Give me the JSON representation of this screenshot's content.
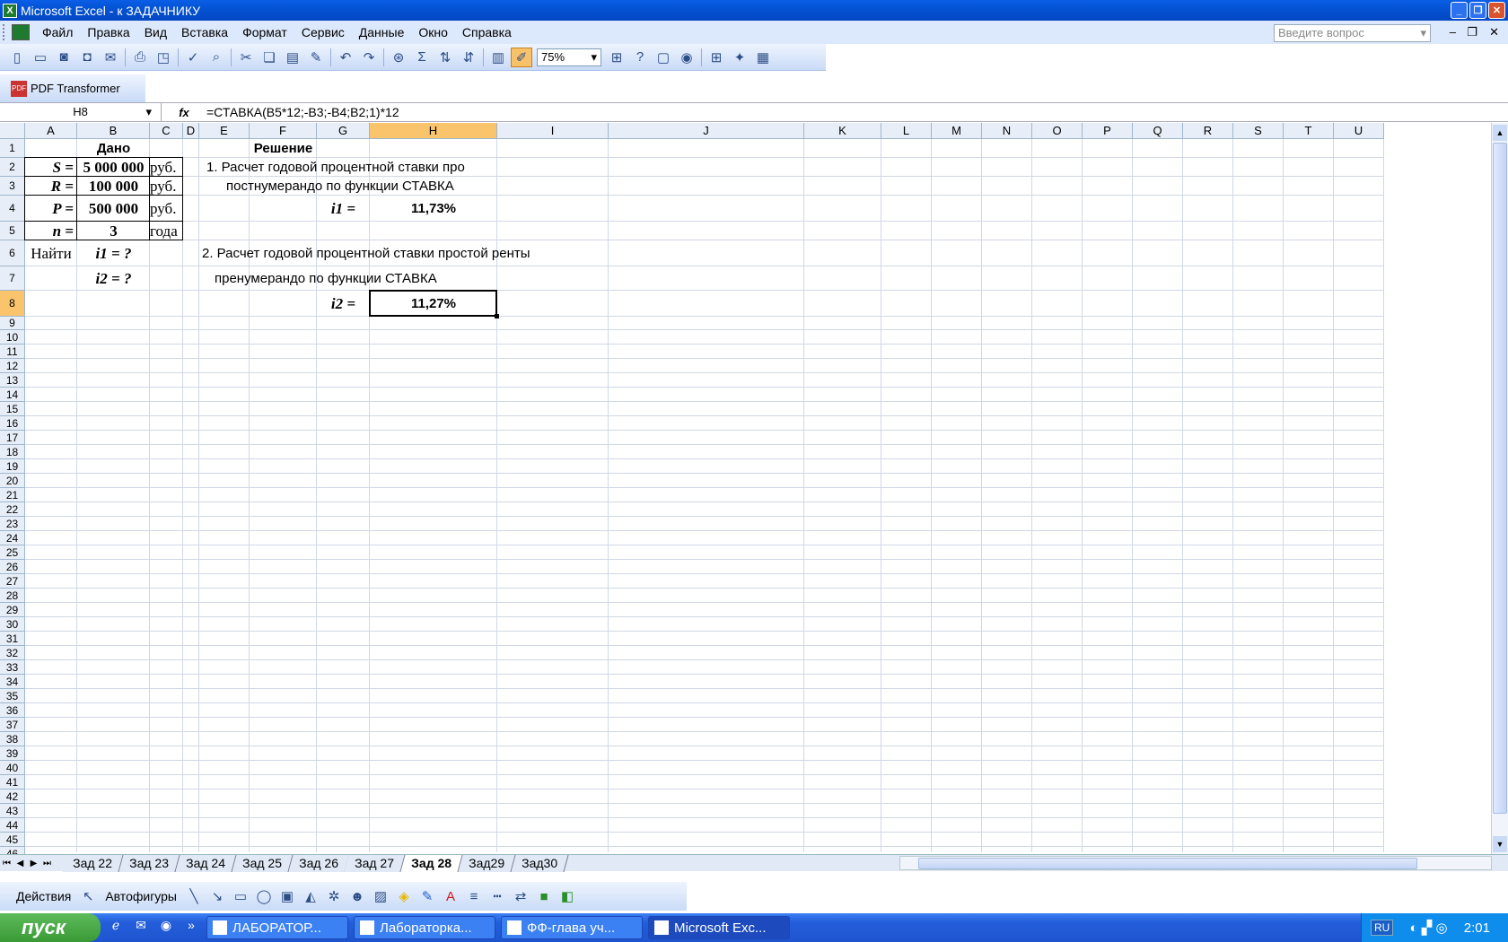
{
  "window": {
    "title": "Microsoft Excel - к ЗАДАЧНИКУ"
  },
  "menu": [
    "Файл",
    "Правка",
    "Вид",
    "Вставка",
    "Формат",
    "Сервис",
    "Данные",
    "Окно",
    "Справка"
  ],
  "help_placeholder": "Введите вопрос",
  "zoom": "75%",
  "pdf_toolbar": "PDF Transformer",
  "namebox": "H8",
  "formula": "=СТАВКА(B5*12;-B3;-B4;B2;1)*12",
  "columns": [
    "A",
    "B",
    "C",
    "D",
    "E",
    "F",
    "G",
    "H",
    "I",
    "J",
    "K",
    "L",
    "M",
    "N",
    "O",
    "P",
    "Q",
    "R",
    "S",
    "T",
    "U"
  ],
  "selected_column": "H",
  "selected_row": 8,
  "cells": {
    "B1": "Дано",
    "F1": "Решение",
    "A2": "S =",
    "B2": "5 000 000",
    "C2": "руб.",
    "A3": "R =",
    "B3": "100 000",
    "C3": "руб.",
    "A4": "P =",
    "B4": "500 000",
    "C4": "руб.",
    "A5": "n =",
    "B5": "3",
    "C5": "года",
    "A6": "Найти",
    "B6": "i1 = ?",
    "B7": "i2 = ?",
    "E2": "1. Расчет годовой процентной ставки про",
    "E3": "постнумерандо по функции СТАВКА",
    "G4": "i1 =",
    "H4": "11,73%",
    "E6": "2. Расчет годовой процентной ставки простой ренты",
    "E7": "пренумерандо по функции СТАВКА",
    "G8": "i2 =",
    "H8": "11,27%"
  },
  "sheet_tabs": [
    "Зад 22",
    "Зад 23",
    "Зад 24",
    "Зад 25",
    "Зад 26",
    "Зад 27",
    "Зад 28",
    "Зад29",
    "Зад30"
  ],
  "active_tab": "Зад 28",
  "drawing_toolbar": {
    "actions": "Действия",
    "autoshapes": "Автофигуры"
  },
  "taskbar": {
    "start": "пуск",
    "tasks": [
      "ЛАБОРАТОР...",
      "Лабораторка...",
      "ФФ-глава уч...",
      "Microsoft Exc..."
    ],
    "active_task": "Microsoft Exc...",
    "lang": "RU",
    "clock": "2:01"
  }
}
